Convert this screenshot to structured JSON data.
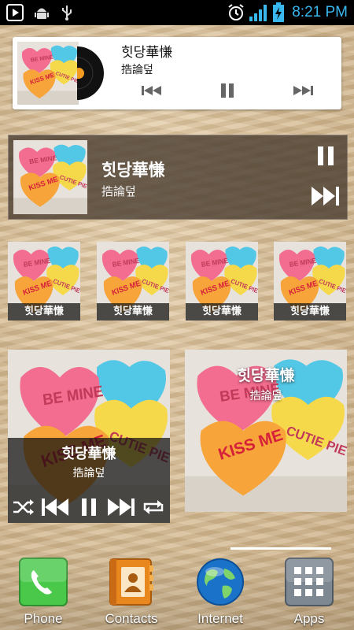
{
  "status_bar": {
    "time": "8:21 PM",
    "icons": [
      "media-play-icon",
      "android-debug-icon",
      "usb-icon",
      "alarm-icon",
      "signal-icon",
      "battery-charging-icon"
    ]
  },
  "song": {
    "title": "힛당華慊",
    "artist": "捁論덮",
    "album_art": "candy-hearts-album-art"
  },
  "widget1": {
    "controls": [
      "previous-icon",
      "pause-icon",
      "next-icon"
    ]
  },
  "widget2": {
    "controls": [
      "pause-icon",
      "next-icon"
    ]
  },
  "thumbs": [
    {
      "caption": "힛당華慊"
    },
    {
      "caption": "힛당華慊"
    },
    {
      "caption": "힛당華慊"
    },
    {
      "caption": "힛당華慊"
    }
  ],
  "widget4": {
    "controls": [
      "shuffle-icon",
      "previous-icon",
      "pause-icon",
      "next-icon",
      "repeat-icon"
    ]
  },
  "dock": {
    "apps": [
      {
        "label": "Phone",
        "icon": "phone-icon"
      },
      {
        "label": "Contacts",
        "icon": "contacts-icon"
      },
      {
        "label": "Internet",
        "icon": "globe-icon"
      },
      {
        "label": "Apps",
        "icon": "apps-grid-icon"
      }
    ]
  },
  "colors": {
    "clock": "#39b8ef",
    "accent_green": "#49c84a",
    "heart_pink": "#f26d8f",
    "heart_yellow": "#f6d94a",
    "heart_orange": "#f7a43a",
    "heart_blue": "#53c7e6"
  }
}
